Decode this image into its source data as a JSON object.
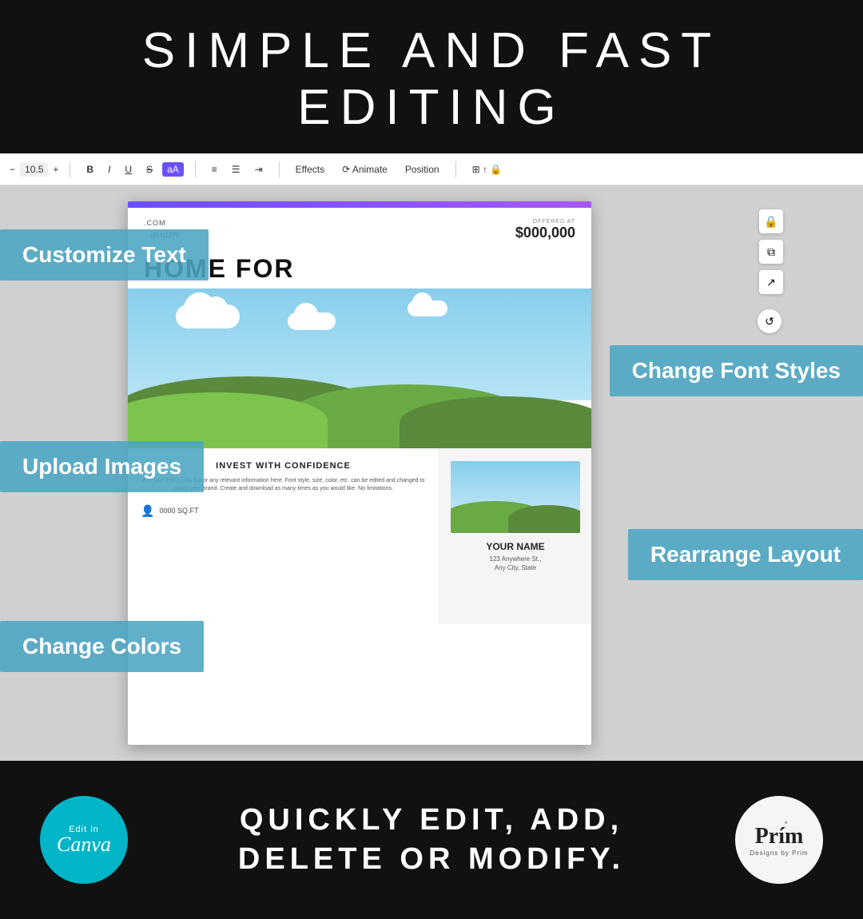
{
  "header": {
    "title": "SIMPLE AND FAST EDITING"
  },
  "toolbar": {
    "font_size": "10.5",
    "font_bold": "B",
    "font_italic": "I",
    "font_underline": "U",
    "font_strikethrough": "S",
    "font_case": "aA",
    "align_left": "≡",
    "align_list": "☰",
    "align_indent": "⇥",
    "effects_label": "Effects",
    "animate_label": "Animate",
    "position_label": "Position"
  },
  "doc": {
    "website": ".COM",
    "phone": "(954)1270",
    "offered_label": "OFFERED AT",
    "price": "$000,000",
    "title": "HOME FOR",
    "invest_title": "INVEST WITH CONFIDENCE",
    "invest_text": "Add your listing info, bio or any relevant information here. Font style, size, color, etc. can be edited and changed to match your brand. Create and download as many times as you would like. No limitations.",
    "sqft": "0000 SQ.FT",
    "agent_name": "YOUR NAME",
    "agent_address": "123 Anywhere St.,\nAny City, State"
  },
  "features": {
    "customize_text": "Customize Text",
    "change_font": "Change Font Styles",
    "upload_images": "Upload Images",
    "rearrange_layout": "Rearrange Layout",
    "change_colors": "Change Colors"
  },
  "footer": {
    "line1": "QUICKLY EDIT, ADD,",
    "line2": "DELETE OR MODIFY.",
    "canva_badge_small": "Edit in",
    "canva_badge_big": "Canva",
    "prim_name": "Prim",
    "prim_sub": "Designs by Prim"
  }
}
